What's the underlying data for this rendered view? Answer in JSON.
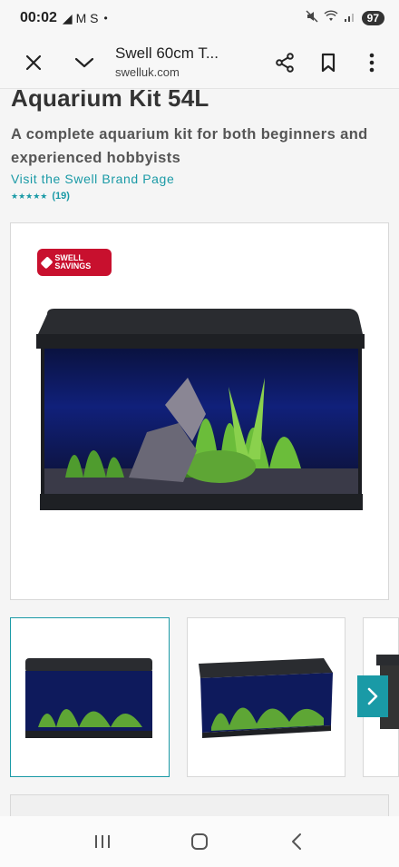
{
  "status_bar": {
    "time": "00:02",
    "notification_glyphs": "◢ M S",
    "dot": "•",
    "battery": "97"
  },
  "browser": {
    "page_title": "Swell 60cm T...",
    "domain": "swelluk.com"
  },
  "product": {
    "title": "Aquarium Kit 54L",
    "subtitle": "A complete aquarium kit for both beginners and experienced hobbyists",
    "brand_link": "Visit the Swell Brand Page",
    "stars": "★★★★★",
    "review_count": "(19)",
    "badge_text": "Swell Savings"
  },
  "colors": {
    "accent": "#1a9aa6",
    "badge": "#c8102e"
  },
  "icons": {
    "close": "close-icon",
    "expand": "chevron-down-icon",
    "share": "share-icon",
    "bookmark": "bookmark-icon",
    "menu": "more-vert-icon",
    "next": "chevron-right-icon"
  }
}
